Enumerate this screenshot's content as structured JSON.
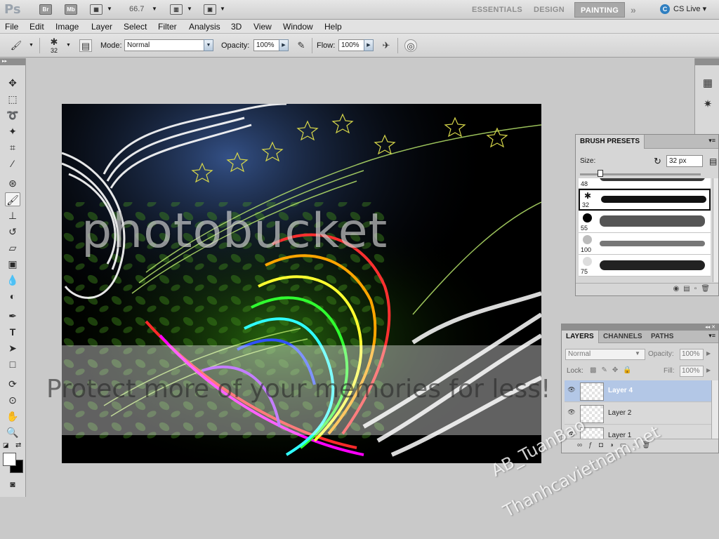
{
  "appbar": {
    "logo": "Ps",
    "bridge": "Br",
    "minibridge": "Mb",
    "zoom": "66.7",
    "workspaces": [
      "ESSENTIALS",
      "DESIGN",
      "PAINTING"
    ],
    "active_workspace": "PAINTING",
    "overflow": "»",
    "cs_live": "CS Live"
  },
  "menubar": [
    "File",
    "Edit",
    "Image",
    "Layer",
    "Select",
    "Filter",
    "Analysis",
    "3D",
    "View",
    "Window",
    "Help"
  ],
  "options": {
    "brush_size": "32",
    "mode_label": "Mode:",
    "mode_value": "Normal",
    "opacity_label": "Opacity:",
    "opacity_value": "100%",
    "flow_label": "Flow:",
    "flow_value": "100%"
  },
  "tools": [
    "move-tool",
    "marquee-tool",
    "lasso-tool",
    "quick-selection-tool",
    "crop-tool",
    "eyedropper-tool",
    "spot-healing-tool",
    "brush-tool",
    "clone-stamp-tool",
    "history-brush-tool",
    "eraser-tool",
    "gradient-tool",
    "blur-tool",
    "dodge-tool",
    "pen-tool",
    "type-tool",
    "path-selection-tool",
    "rectangle-tool",
    "3d-rotate-tool",
    "3d-orbit-tool",
    "hand-tool",
    "zoom-tool"
  ],
  "brush_presets": {
    "tab": "BRUSH PRESETS",
    "size_label": "Size:",
    "size_value": "32 px",
    "items": [
      {
        "size": "48"
      },
      {
        "size": "32"
      },
      {
        "size": "55"
      },
      {
        "size": "100"
      },
      {
        "size": "75"
      }
    ]
  },
  "layers_panel": {
    "tabs": [
      "LAYERS",
      "CHANNELS",
      "PATHS"
    ],
    "blend_mode": "Normal",
    "opacity_label": "Opacity:",
    "opacity_value": "100%",
    "lock_label": "Lock:",
    "fill_label": "Fill:",
    "fill_value": "100%",
    "layers": [
      {
        "name": "Layer 4",
        "selected": true
      },
      {
        "name": "Layer 2",
        "selected": false
      },
      {
        "name": "Layer 1",
        "selected": false
      }
    ]
  },
  "watermark": {
    "brand": "photobucket",
    "slogan": "Protect more of your memories for less!",
    "author": "AB_TuanBao",
    "site": "Thanhcavietnam.net"
  },
  "colors": {
    "selection": "#b3c7e6",
    "canvas_bg": "#000000",
    "workspace_bg": "#c9c9c9"
  }
}
